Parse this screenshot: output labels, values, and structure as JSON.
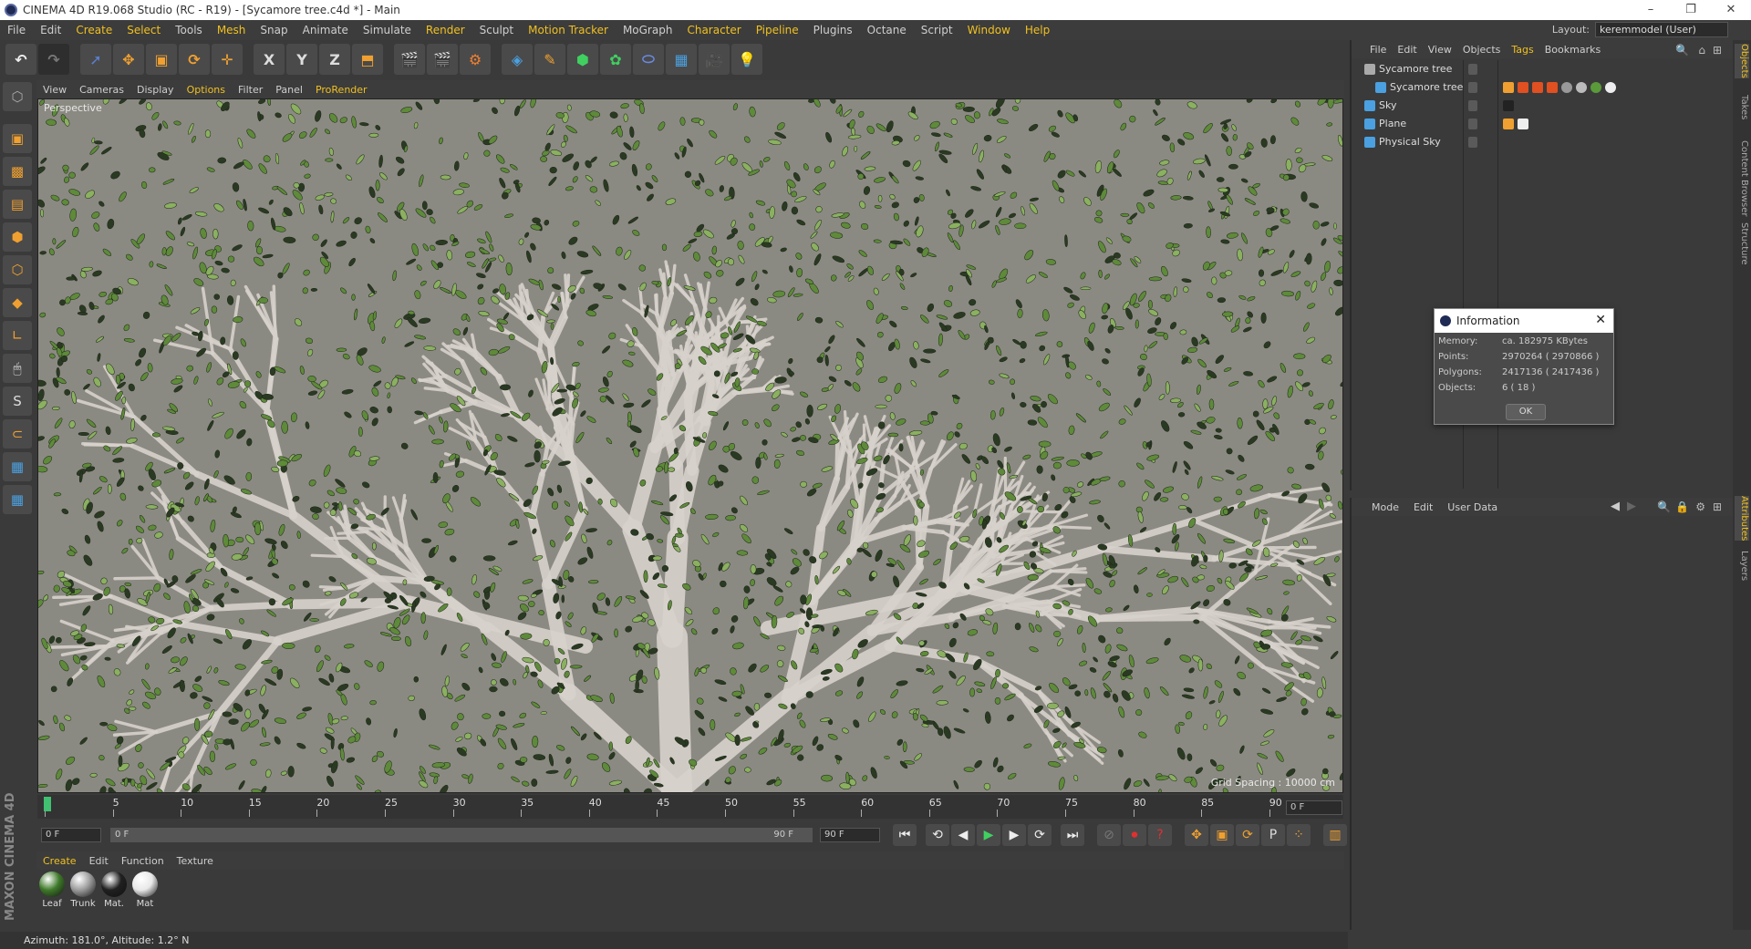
{
  "window": {
    "title": "CINEMA 4D R19.068 Studio (RC - R19) - [Sycamore tree.c4d *] - Main"
  },
  "menubar": {
    "items": [
      {
        "label": "File",
        "hl": false
      },
      {
        "label": "Edit",
        "hl": false
      },
      {
        "label": "Create",
        "hl": true
      },
      {
        "label": "Select",
        "hl": true
      },
      {
        "label": "Tools",
        "hl": false
      },
      {
        "label": "Mesh",
        "hl": true
      },
      {
        "label": "Snap",
        "hl": false
      },
      {
        "label": "Animate",
        "hl": false
      },
      {
        "label": "Simulate",
        "hl": false
      },
      {
        "label": "Render",
        "hl": true
      },
      {
        "label": "Sculpt",
        "hl": false
      },
      {
        "label": "Motion Tracker",
        "hl": true
      },
      {
        "label": "MoGraph",
        "hl": false
      },
      {
        "label": "Character",
        "hl": true
      },
      {
        "label": "Pipeline",
        "hl": true
      },
      {
        "label": "Plugins",
        "hl": false
      },
      {
        "label": "Octane",
        "hl": false
      },
      {
        "label": "Script",
        "hl": false
      },
      {
        "label": "Window",
        "hl": true
      },
      {
        "label": "Help",
        "hl": true
      }
    ],
    "layout_label": "Layout:",
    "layout_value": "keremmodel (User)"
  },
  "viewport": {
    "menu": [
      {
        "label": "View",
        "hl": false
      },
      {
        "label": "Cameras",
        "hl": false
      },
      {
        "label": "Display",
        "hl": false
      },
      {
        "label": "Options",
        "hl": true
      },
      {
        "label": "Filter",
        "hl": false
      },
      {
        "label": "Panel",
        "hl": false
      },
      {
        "label": "ProRender",
        "hl": true
      }
    ],
    "camera_label": "Perspective",
    "grid_spacing": "Grid Spacing : 10000 cm"
  },
  "timeline": {
    "ticks": [
      "0",
      "5",
      "10",
      "15",
      "20",
      "25",
      "30",
      "35",
      "40",
      "45",
      "50",
      "55",
      "60",
      "65",
      "70",
      "75",
      "80",
      "85",
      "90"
    ],
    "current_frame": "0 F",
    "start_field": "0 F",
    "range_start": "0 F",
    "range_end": "90 F",
    "end_field": "90 F"
  },
  "material_manager": {
    "menu": [
      {
        "label": "Create",
        "hl": true
      },
      {
        "label": "Edit",
        "hl": false
      },
      {
        "label": "Function",
        "hl": false
      },
      {
        "label": "Texture",
        "hl": false
      }
    ],
    "materials": [
      {
        "name": "Leaf",
        "color": "#3f7a2a"
      },
      {
        "name": "Trunk",
        "color": "#9c9c9c"
      },
      {
        "name": "Mat.",
        "color": "#202020"
      },
      {
        "name": "Mat",
        "color": "#e8e8e8"
      }
    ]
  },
  "statusbar": {
    "text": "Azimuth: 181.0°, Altitude: 1.2°  N"
  },
  "object_manager": {
    "menu": [
      {
        "label": "File",
        "hl": false
      },
      {
        "label": "Edit",
        "hl": false
      },
      {
        "label": "View",
        "hl": false
      },
      {
        "label": "Objects",
        "hl": false
      },
      {
        "label": "Tags",
        "hl": true
      },
      {
        "label": "Bookmarks",
        "hl": false
      }
    ],
    "objects": [
      {
        "name": "Sycamore tree"
      },
      {
        "name": "Sycamore tree"
      },
      {
        "name": "Sky"
      },
      {
        "name": "Plane"
      },
      {
        "name": "Physical Sky"
      }
    ]
  },
  "attribute_manager": {
    "menu": [
      {
        "label": "Mode"
      },
      {
        "label": "Edit"
      },
      {
        "label": "User Data"
      }
    ]
  },
  "right_tabs": [
    {
      "label": "Objects",
      "active": true
    },
    {
      "label": "Takes",
      "active": false
    },
    {
      "label": "Content Browser",
      "active": false
    },
    {
      "label": "Structure",
      "active": false
    },
    {
      "label": "Attributes",
      "active": true
    },
    {
      "label": "Layers",
      "active": false
    }
  ],
  "info_dialog": {
    "title": "Information",
    "rows": [
      {
        "label": "Memory:",
        "value": "ca. 182975 KBytes"
      },
      {
        "label": "Points:",
        "value": "2970264 ( 2970866 )"
      },
      {
        "label": "Polygons:",
        "value": "2417136 ( 2417436 )"
      },
      {
        "label": "Objects:",
        "value": "6 ( 18 )"
      }
    ],
    "ok_label": "OK"
  },
  "colors": {
    "accent": "#f0c020",
    "leaf_green": "#5e8a3a",
    "branch": "#d8d2cc",
    "viewport_bg": "#8b8a82"
  }
}
